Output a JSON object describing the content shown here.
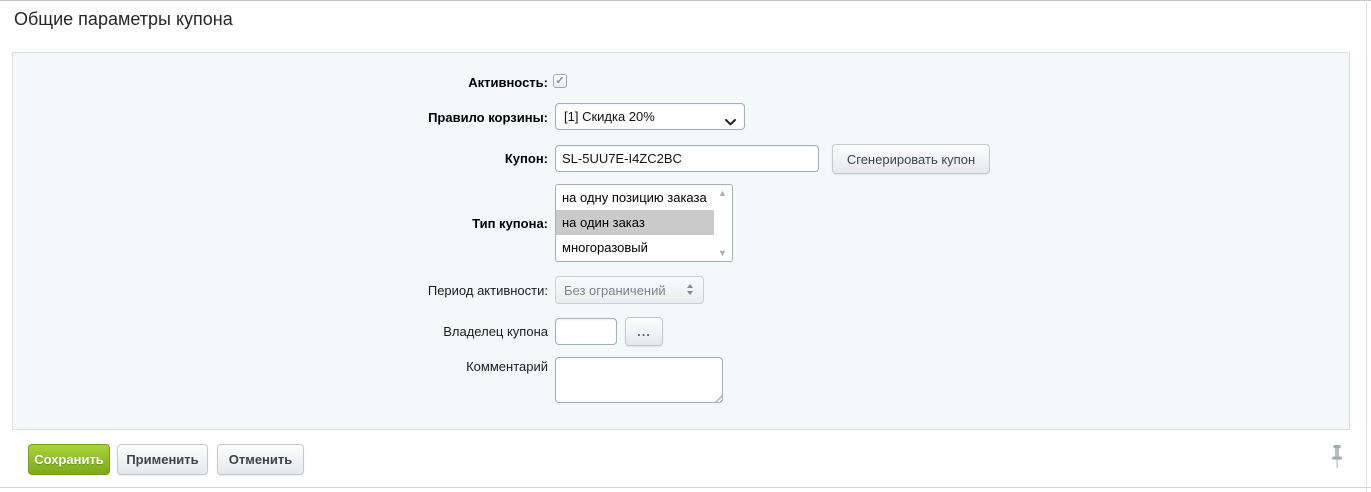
{
  "page": {
    "title": "Общие параметры купона"
  },
  "form": {
    "activity": {
      "label": "Активность:",
      "checked": true
    },
    "basket_rule": {
      "label": "Правило корзины:",
      "value": "[1] Скидка 20%"
    },
    "coupon": {
      "label": "Купон:",
      "value": "SL-5UU7E-I4ZC2BC",
      "generate_button_label": "Сгенерировать купон"
    },
    "coupon_type": {
      "label": "Тип купона:",
      "options": [
        "на одну позицию заказа",
        "на один заказ",
        "многоразовый"
      ],
      "selected_option": "на один заказ"
    },
    "active_period": {
      "label": "Период активности:",
      "value": "Без ограничений"
    },
    "coupon_owner": {
      "label": "Владелец купона",
      "value": "",
      "browse_button_label": "..."
    },
    "comment": {
      "label": "Комментарий",
      "value": ""
    }
  },
  "footer": {
    "save_label": "Сохранить",
    "apply_label": "Применить",
    "cancel_label": "Отменить"
  },
  "icons": {
    "checkbox_check": "✓",
    "scroll_up_arrow": "▲",
    "scroll_down_arrow": "▼"
  },
  "colors": {
    "accent_green": "#8cb515",
    "panel_background": "#f4f8f9",
    "panel_border": "#d9dee1",
    "selected_option_background": "#cacaca"
  }
}
